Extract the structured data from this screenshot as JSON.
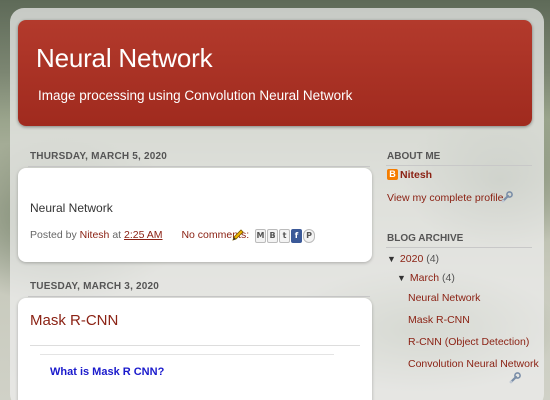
{
  "blog": {
    "title": "Neural Network",
    "description": "Image processing using Convolution Neural Network"
  },
  "posts": [
    {
      "date": "THURSDAY, MARCH 5, 2020",
      "body": "Neural Network",
      "posted_by_label": "Posted by",
      "author": "Nitesh",
      "at_label": "at",
      "time": "2:25 AM",
      "comments": "No comments:"
    },
    {
      "date": "TUESDAY, MARCH 3, 2020",
      "title": "Mask R-CNN",
      "subheading": "What is Mask R CNN?"
    }
  ],
  "share_buttons": [
    {
      "label": "M",
      "icon": "email-icon"
    },
    {
      "label": "B",
      "icon": "blogthis-icon"
    },
    {
      "label": "t",
      "icon": "twitter-icon"
    },
    {
      "label": "f",
      "icon": "facebook-icon"
    },
    {
      "label": "P",
      "icon": "pinterest-icon"
    }
  ],
  "sidebar": {
    "about": {
      "heading": "ABOUT ME",
      "name": "Nitesh",
      "profile_link": "View my complete profile"
    },
    "archive": {
      "heading": "BLOG ARCHIVE",
      "year": "2020",
      "year_count": "(4)",
      "month": "March",
      "month_count": "(4)",
      "posts": [
        "Neural Network",
        "Mask R-CNN",
        "R-CNN (Object Detection)",
        "Convolution Neural Network"
      ]
    }
  },
  "colors": {
    "header": "#a02a1e",
    "link": "#8b2214",
    "subhead": "#1a1acc"
  }
}
